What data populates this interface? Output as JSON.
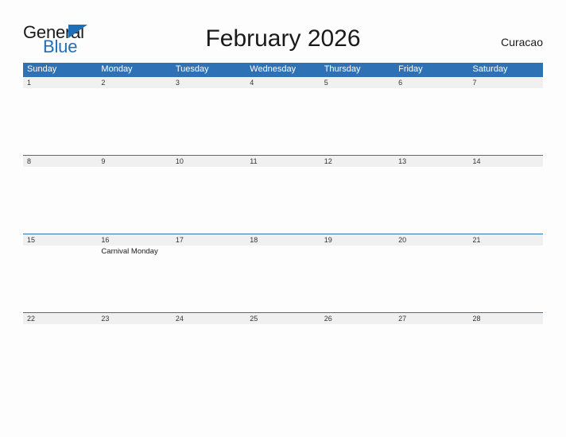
{
  "branding": {
    "logo_text_primary": "General",
    "logo_text_secondary": "Blue",
    "logo_triangle_icon": "triangle-flag-icon",
    "logo_accent_color": "#1f6fb8"
  },
  "header": {
    "title": "February 2026",
    "country": "Curacao"
  },
  "colors": {
    "header_blue": "#2e72b5",
    "date_band_gray": "#f0f0f0",
    "page_background": "#fdfdfd",
    "text_dark": "#1a1a1a",
    "weekday_text": "#ffffff"
  },
  "calendar": {
    "month": "February",
    "year": "2026",
    "weekday_headers": [
      "Sunday",
      "Monday",
      "Tuesday",
      "Wednesday",
      "Thursday",
      "Friday",
      "Saturday"
    ],
    "weeks": [
      {
        "days": [
          {
            "date": "1",
            "events": []
          },
          {
            "date": "2",
            "events": []
          },
          {
            "date": "3",
            "events": []
          },
          {
            "date": "4",
            "events": []
          },
          {
            "date": "5",
            "events": []
          },
          {
            "date": "6",
            "events": []
          },
          {
            "date": "7",
            "events": []
          }
        ]
      },
      {
        "days": [
          {
            "date": "8",
            "events": []
          },
          {
            "date": "9",
            "events": []
          },
          {
            "date": "10",
            "events": []
          },
          {
            "date": "11",
            "events": []
          },
          {
            "date": "12",
            "events": []
          },
          {
            "date": "13",
            "events": []
          },
          {
            "date": "14",
            "events": []
          }
        ]
      },
      {
        "days": [
          {
            "date": "15",
            "events": []
          },
          {
            "date": "16",
            "events": [
              "Carnival Monday"
            ]
          },
          {
            "date": "17",
            "events": []
          },
          {
            "date": "18",
            "events": []
          },
          {
            "date": "19",
            "events": []
          },
          {
            "date": "20",
            "events": []
          },
          {
            "date": "21",
            "events": []
          }
        ]
      },
      {
        "days": [
          {
            "date": "22",
            "events": []
          },
          {
            "date": "23",
            "events": []
          },
          {
            "date": "24",
            "events": []
          },
          {
            "date": "25",
            "events": []
          },
          {
            "date": "26",
            "events": []
          },
          {
            "date": "27",
            "events": []
          },
          {
            "date": "28",
            "events": []
          }
        ]
      }
    ]
  }
}
